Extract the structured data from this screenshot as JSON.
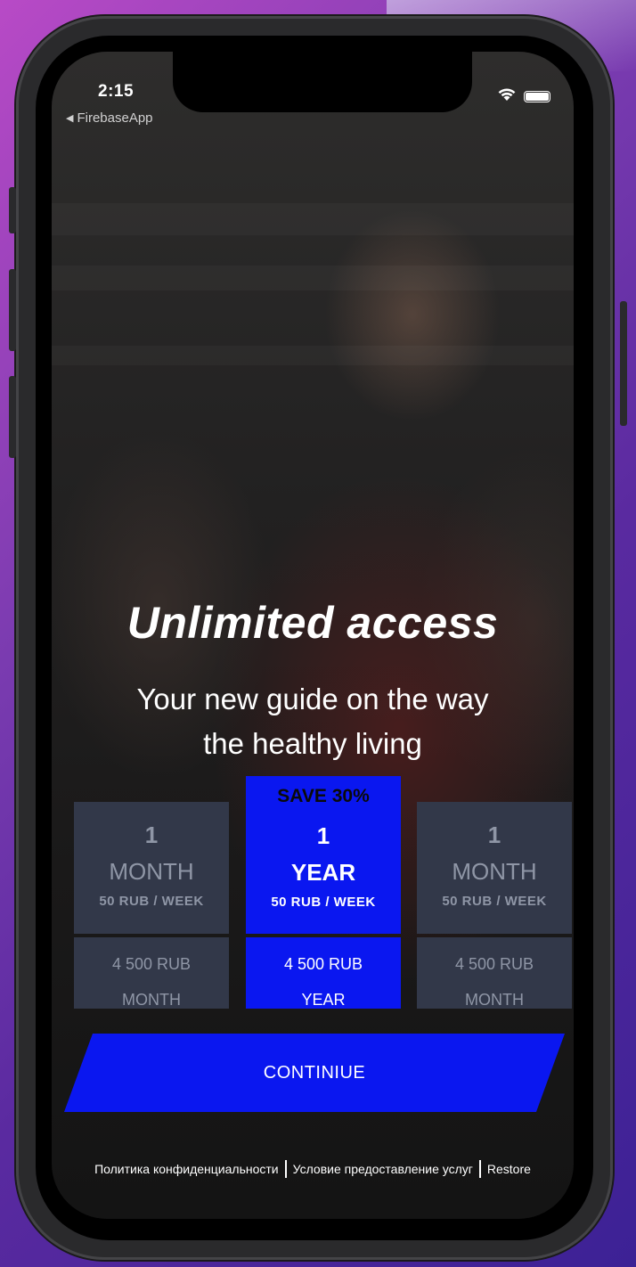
{
  "status_bar": {
    "time": "2:15",
    "back_label": "FirebaseApp"
  },
  "hero": {
    "title": "Unlimited access",
    "subtitle_line1": "Your new guide on the way",
    "subtitle_line2": "the healthy living"
  },
  "plans": [
    {
      "number": "1",
      "unit": "MONTH",
      "rate": "50 RUB / WEEK",
      "price": "4 500 RUB",
      "period": "MONTH",
      "selected": false
    },
    {
      "badge": "SAVE 30%",
      "number": "1",
      "unit": "YEAR",
      "rate": "50 RUB / WEEK",
      "price": "4 500 RUB",
      "period": "YEAR",
      "selected": true
    },
    {
      "number": "1",
      "unit": "MONTH",
      "rate": "50 RUB / WEEK",
      "price": "4 500 RUB",
      "period": "MONTH",
      "selected": false
    }
  ],
  "continue_label": "CONTINIUE",
  "footer": {
    "privacy": "Политика конфиденциальности",
    "terms": "Условие предоставление услуг",
    "restore": "Restore"
  },
  "colors": {
    "accent": "#0a17f0",
    "plan_inactive": "#323849",
    "plan_inactive_text": "#8f96a6"
  },
  "icons": [
    "back-arrow-icon",
    "wifi-icon",
    "battery-icon"
  ]
}
